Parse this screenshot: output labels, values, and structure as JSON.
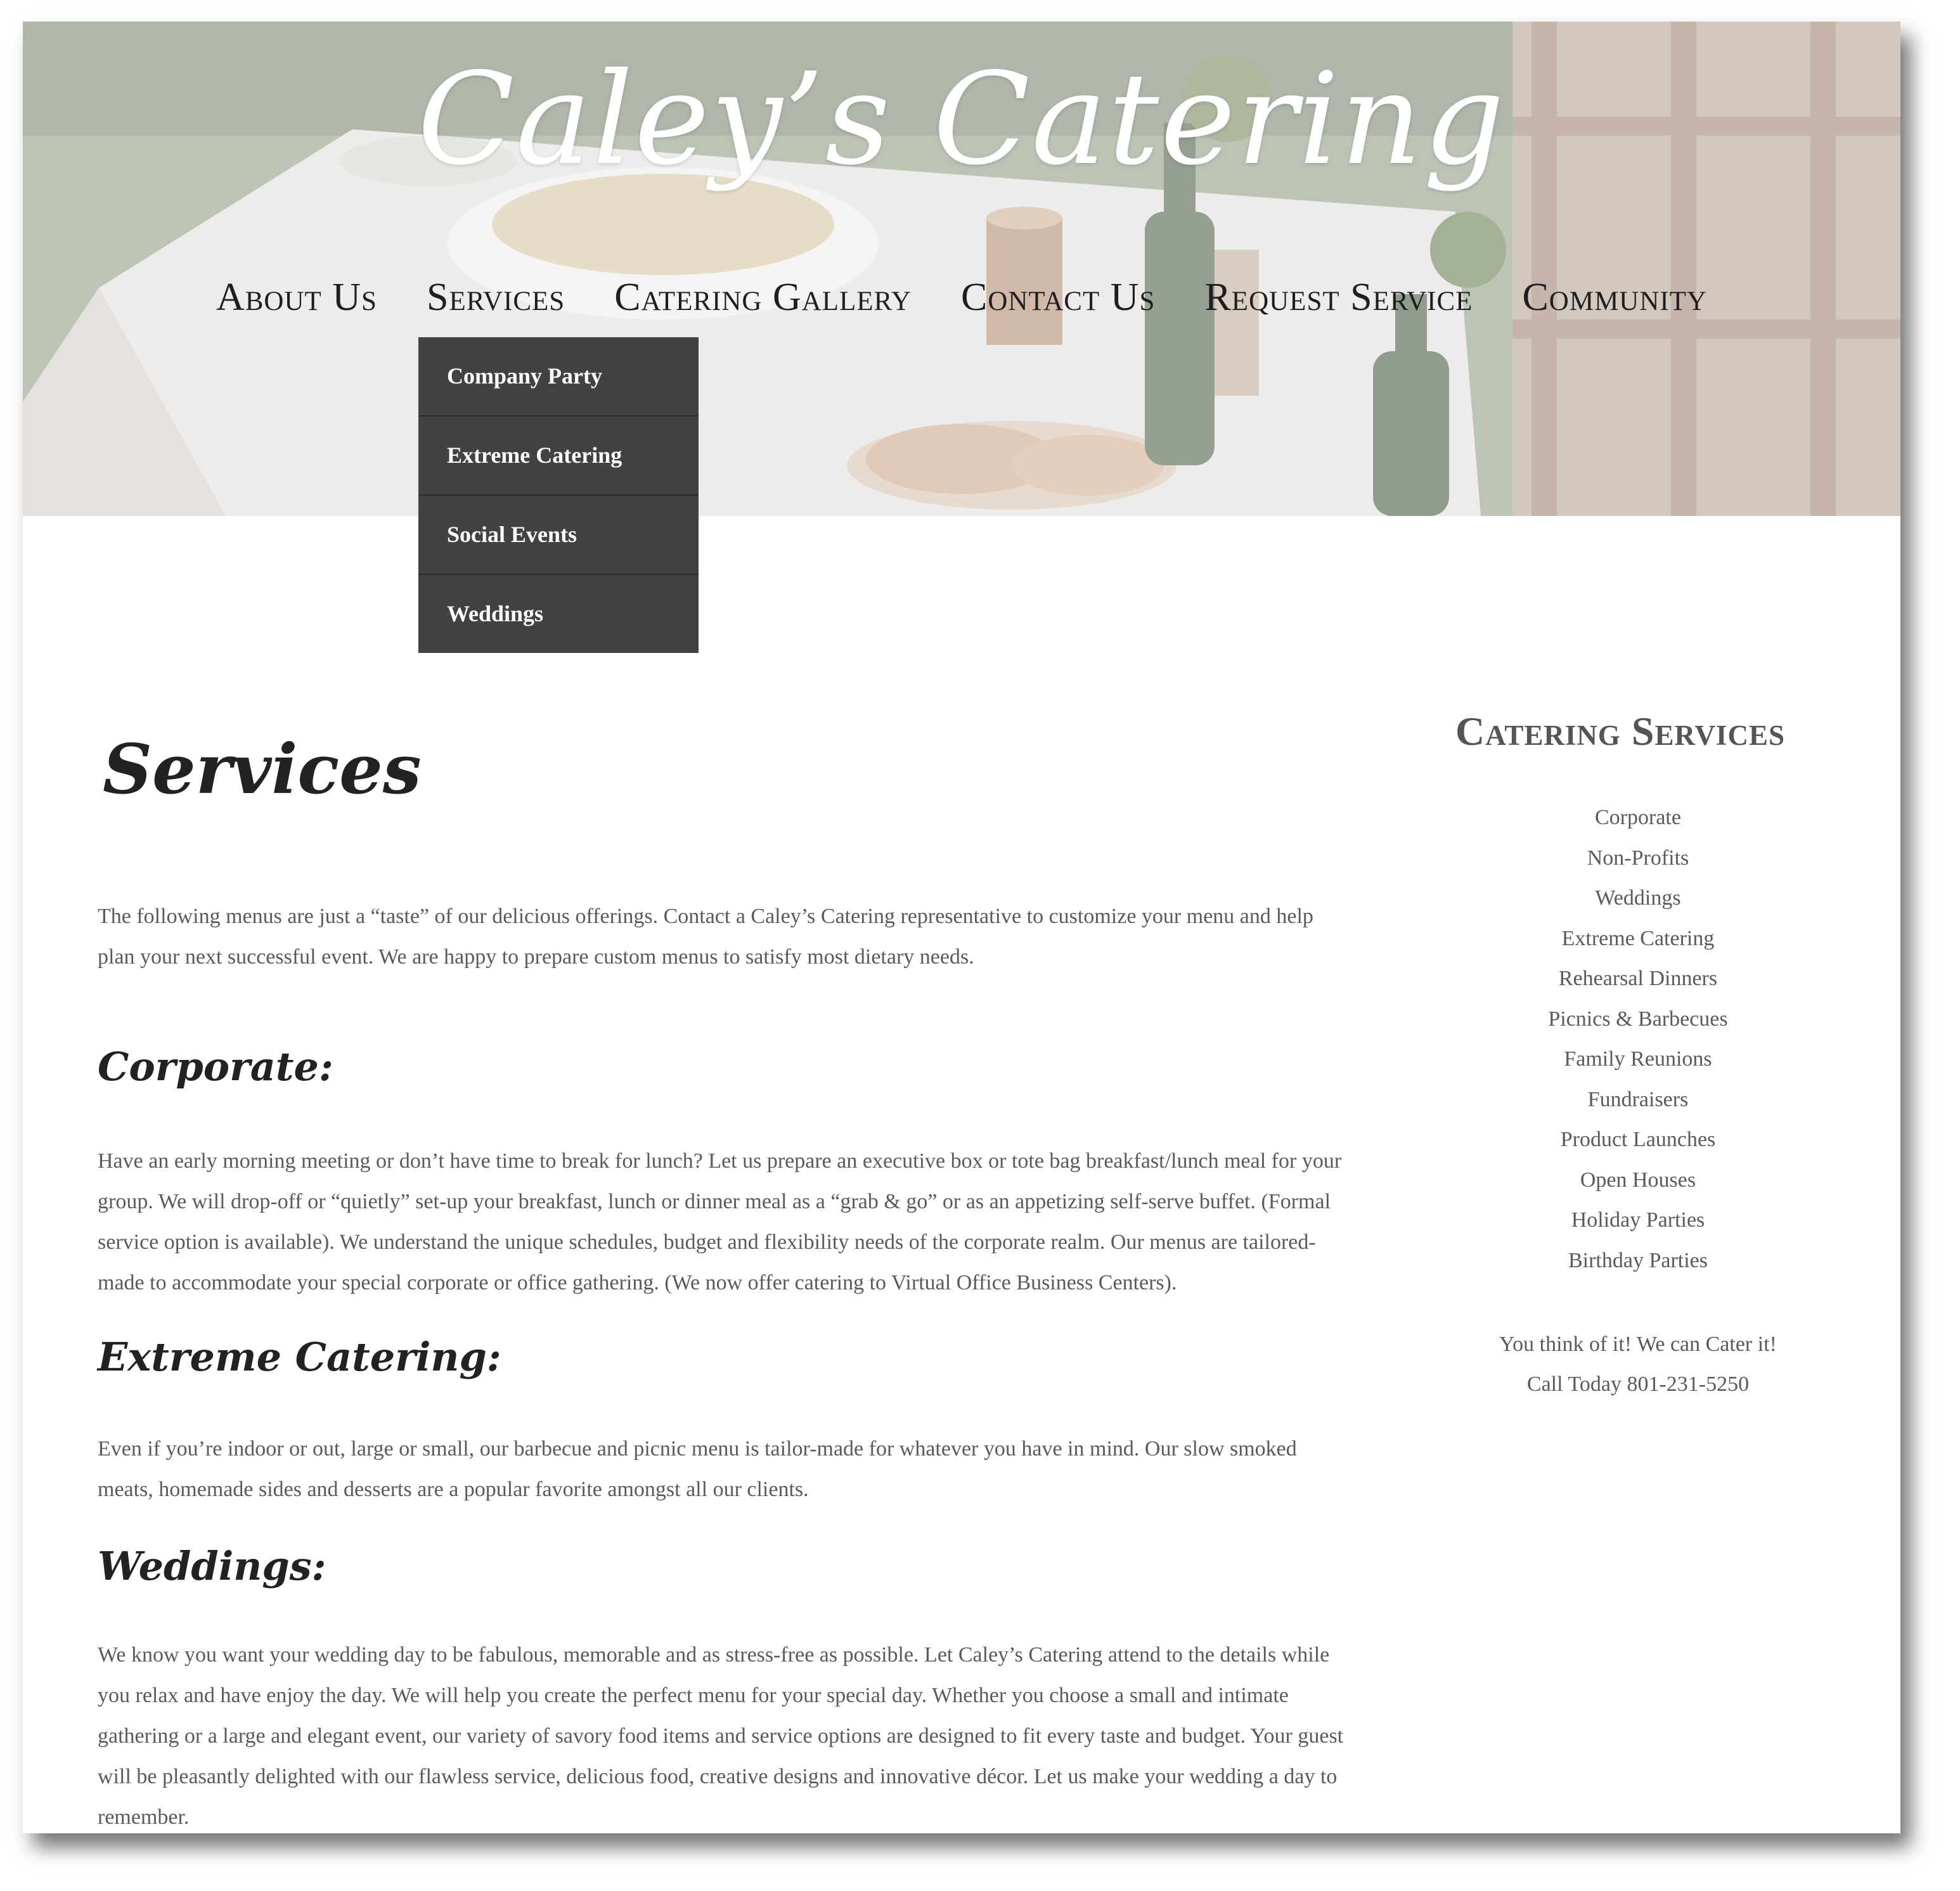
{
  "site": {
    "title": "Caley’s Catering"
  },
  "nav": {
    "items": [
      {
        "id": "about",
        "label": "About Us"
      },
      {
        "id": "services",
        "label": "Services"
      },
      {
        "id": "gallery",
        "label": "Catering Gallery"
      },
      {
        "id": "contact",
        "label": "Contact Us"
      },
      {
        "id": "request",
        "label": "Request Service"
      },
      {
        "id": "community",
        "label": "Community"
      }
    ],
    "services_dropdown": [
      "Company Party",
      "Extreme Catering",
      "Social Events",
      "Weddings"
    ]
  },
  "main": {
    "title": "Services",
    "intro": "The following menus are just a “taste” of our delicious offerings. Contact a Caley’s Catering representative to customize your menu and help plan your next successful event. We are happy to prepare custom menus to satisfy most dietary needs.",
    "sections": [
      {
        "heading": "Corporate:",
        "body": "Have an early morning meeting or don’t have time to break for lunch? Let us prepare an executive box or tote bag breakfast/lunch meal for your group. We will drop-off or “quietly” set-up your breakfast, lunch or dinner meal as a “grab & go” or as an appetizing self-serve buffet. (Formal service option is available). We understand the unique schedules, budget and flexibility needs of the corporate realm. Our menus are tailored-made to accommodate your special corporate or office gathering. (We now offer catering to Virtual Office Business Centers)."
      },
      {
        "heading": "Extreme Catering:",
        "body": "Even if you’re indoor or out, large or small, our barbecue and picnic menu is tailor-made for whatever you have in mind. Our slow smoked meats, homemade sides and desserts are a popular favorite amongst all our clients."
      },
      {
        "heading": "Weddings:",
        "body": "We know you want your wedding day to be fabulous, memorable and as stress-free as possible. Let Caley’s Catering attend to the details while you relax and have enjoy the day. We will help you create the perfect menu for your special day. Whether you choose a small and intimate gathering or a large and elegant event, our variety of savory food items and service options are designed to fit every taste and budget. Your guest will be pleasantly delighted with our flawless service, delicious food, creative designs and innovative décor. Let us make your wedding a day to remember."
      }
    ]
  },
  "sidebar": {
    "title": "Catering Services",
    "services": [
      "Corporate",
      "Non-Profits",
      "Weddings",
      "Extreme Catering",
      "Rehearsal Dinners",
      "Picnics & Barbecues",
      "Family Reunions",
      "Fundraisers",
      "Product Launches",
      "Open Houses",
      "Holiday Parties",
      "Birthday Parties"
    ],
    "tagline_line1": "You think of it! We can Cater it!",
    "tagline_line2": "Call Today 801-231-5250"
  },
  "colors": {
    "dropdown_bg": "#424242",
    "nav_text": "#1e1e1e",
    "body_text": "#5a5a5a",
    "heading_text": "#222222"
  }
}
